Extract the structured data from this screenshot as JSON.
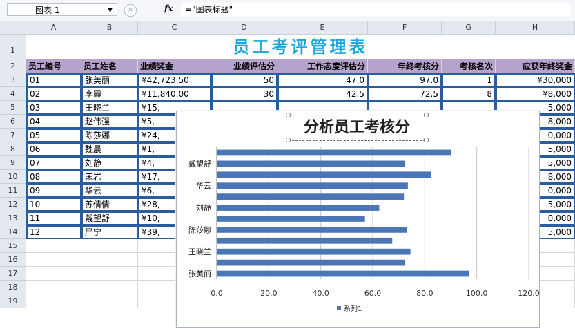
{
  "formula_bar": {
    "name_box": "图表 1",
    "fx_label": "fx",
    "formula": "=\"图表标题\""
  },
  "columns": [
    "A",
    "B",
    "C",
    "D",
    "E",
    "F",
    "G",
    "H"
  ],
  "rows": [
    "1",
    "2",
    "3",
    "4",
    "5",
    "6",
    "7",
    "8",
    "9",
    "10",
    "11",
    "12",
    "13",
    "14",
    "15",
    "16",
    "17",
    "18",
    "19"
  ],
  "sheet": {
    "title": "员工考评管理表",
    "headers": [
      "员工编号",
      "员工姓名",
      "业绩奖金",
      "业绩评估分",
      "工作态度评估分",
      "年终考核分",
      "考核名次",
      "应获年终奖金"
    ],
    "table_rows": [
      [
        "01",
        "张美丽",
        "¥42,723.50",
        "50",
        "47.0",
        "97.0",
        "1",
        "¥30,000"
      ],
      [
        "02",
        "李霞",
        "¥11,840.00",
        "30",
        "42.5",
        "72.5",
        "8",
        "¥8,000"
      ],
      [
        "03",
        "王晓兰",
        "¥15,",
        "",
        "",
        "",
        "",
        "5,000"
      ],
      [
        "04",
        "赵伟强",
        "¥5,",
        "",
        "",
        "",
        "",
        "8,000"
      ],
      [
        "05",
        "陈莎娜",
        "¥24,",
        "",
        "",
        "",
        "",
        "0,000"
      ],
      [
        "06",
        "魏晨",
        "¥1,",
        "",
        "",
        "",
        "",
        "5,000"
      ],
      [
        "07",
        "刘静",
        "¥4,",
        "",
        "",
        "",
        "",
        "5,000"
      ],
      [
        "08",
        "宋岩",
        "¥17,",
        "",
        "",
        "",
        "",
        "8,000"
      ],
      [
        "09",
        "华云",
        "¥6,",
        "",
        "",
        "",
        "",
        "0,000"
      ],
      [
        "10",
        "苏倩倩",
        "¥28,",
        "",
        "",
        "",
        "",
        "5,000"
      ],
      [
        "11",
        "戴望舒",
        "¥10,",
        "",
        "",
        "",
        "",
        "0,000"
      ],
      [
        "12",
        "严宁",
        "¥39,",
        "",
        "",
        "",
        "",
        "5,000"
      ]
    ]
  },
  "chart": {
    "title": "分析员工考核分",
    "legend_label": "系列1"
  },
  "chart_data": {
    "type": "bar",
    "orientation": "horizontal",
    "title": "分析员工考核分",
    "category_labels_shown": [
      "张美丽",
      "王晓兰",
      "陈莎娜",
      "刘静",
      "华云",
      "戴望舒"
    ],
    "categories": [
      "张美丽",
      "李霞",
      "王晓兰",
      "赵伟强",
      "陈莎娜",
      "魏晨",
      "刘静",
      "宋岩",
      "华云",
      "苏倩倩",
      "戴望舒",
      "严宁"
    ],
    "series": [
      {
        "name": "系列1",
        "values": [
          97.0,
          72.5,
          74.5,
          67.5,
          73.0,
          57.0,
          62.5,
          72.0,
          73.5,
          82.5,
          72.5,
          90.0
        ]
      }
    ],
    "xlim": [
      0,
      120
    ],
    "xticks": [
      "0.0",
      "20.0",
      "40.0",
      "60.0",
      "80.0",
      "100.0",
      "120.0"
    ],
    "color": "#4a76b5",
    "grid": true,
    "legend": "bottom"
  }
}
